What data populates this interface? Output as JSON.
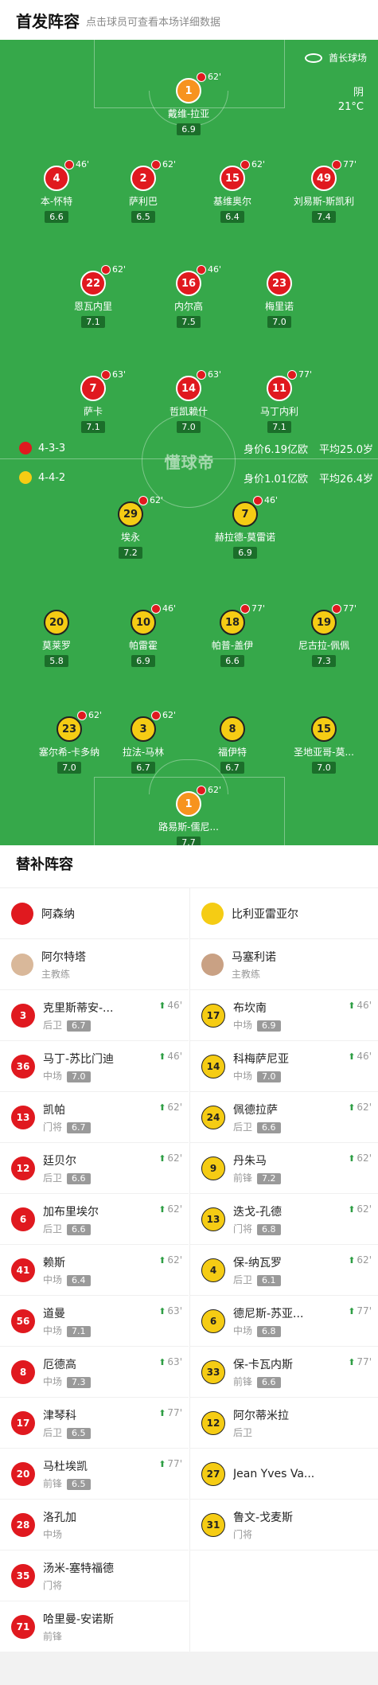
{
  "header": {
    "title": "首发阵容",
    "subtitle": "点击球员可查看本场详细数据"
  },
  "pitch": {
    "stadium": "酋长球场",
    "weather": "阴",
    "temperature": "21°C",
    "watermark": "懂球帝",
    "home": {
      "formation": "4-3-3",
      "value": "身价6.19亿欧",
      "avg_age": "平均25.0岁",
      "color": "#e0191f"
    },
    "away": {
      "formation": "4-4-2",
      "value": "身价1.01亿欧",
      "avg_age": "平均26.4岁",
      "color": "#f5cc14"
    },
    "players": [
      {
        "num": "1",
        "name": "戴维-拉亚",
        "rating": "6.9",
        "sub": "62'",
        "side": "gk"
      },
      {
        "num": "4",
        "name": "本-怀特",
        "rating": "6.6",
        "sub": "46'",
        "side": "home"
      },
      {
        "num": "2",
        "name": "萨利巴",
        "rating": "6.5",
        "sub": "62'",
        "side": "home"
      },
      {
        "num": "15",
        "name": "基维奥尔",
        "rating": "6.4",
        "sub": "62'",
        "side": "home"
      },
      {
        "num": "49",
        "name": "刘易斯-斯凯利",
        "rating": "7.4",
        "sub": "77'",
        "side": "home"
      },
      {
        "num": "22",
        "name": "恩瓦内里",
        "rating": "7.1",
        "sub": "62'",
        "side": "home"
      },
      {
        "num": "16",
        "name": "内尔高",
        "rating": "7.5",
        "sub": "46'",
        "side": "home"
      },
      {
        "num": "23",
        "name": "梅里诺",
        "rating": "7.0",
        "sub": "",
        "side": "home"
      },
      {
        "num": "7",
        "name": "萨卡",
        "rating": "7.1",
        "sub": "63'",
        "side": "home"
      },
      {
        "num": "14",
        "name": "哲凯赖什",
        "rating": "7.0",
        "sub": "63'",
        "side": "home"
      },
      {
        "num": "11",
        "name": "马丁内利",
        "rating": "7.1",
        "sub": "77'",
        "side": "home"
      },
      {
        "num": "29",
        "name": "埃永",
        "rating": "7.2",
        "sub": "62'",
        "side": "away"
      },
      {
        "num": "7",
        "name": "赫拉德-莫雷诺",
        "rating": "6.9",
        "sub": "46'",
        "side": "away"
      },
      {
        "num": "20",
        "name": "莫莱罗",
        "rating": "5.8",
        "sub": "",
        "side": "away"
      },
      {
        "num": "10",
        "name": "帕雷霍",
        "rating": "6.9",
        "sub": "46'",
        "side": "away"
      },
      {
        "num": "18",
        "name": "帕普-盖伊",
        "rating": "6.6",
        "sub": "77'",
        "side": "away"
      },
      {
        "num": "19",
        "name": "尼古拉-佩佩",
        "rating": "7.3",
        "sub": "77'",
        "side": "away"
      },
      {
        "num": "23",
        "name": "塞尔希-卡多纳",
        "rating": "7.0",
        "sub": "62'",
        "side": "away"
      },
      {
        "num": "3",
        "name": "拉法-马林",
        "rating": "6.7",
        "sub": "62'",
        "side": "away"
      },
      {
        "num": "8",
        "name": "福伊特",
        "rating": "6.7",
        "sub": "",
        "side": "away"
      },
      {
        "num": "15",
        "name": "圣地亚哥-莫...",
        "rating": "7.0",
        "sub": "",
        "side": "away"
      },
      {
        "num": "1",
        "name": "路易斯-儒尼...",
        "rating": "7.7",
        "sub": "62'",
        "side": "gk"
      }
    ]
  },
  "subs_section": {
    "title": "替补阵容"
  },
  "home_subs": {
    "team": "阿森纳",
    "coach": "阿尔特塔",
    "coach_role": "主教练",
    "players": [
      {
        "num": "3",
        "name": "克里斯蒂安-...",
        "pos": "后卫",
        "rating": "6.7",
        "min": "46'"
      },
      {
        "num": "36",
        "name": "马丁-苏比门迪",
        "pos": "中场",
        "rating": "7.0",
        "min": "46'"
      },
      {
        "num": "13",
        "name": "凯帕",
        "pos": "门将",
        "rating": "6.7",
        "min": "62'"
      },
      {
        "num": "12",
        "name": "廷贝尔",
        "pos": "后卫",
        "rating": "6.6",
        "min": "62'"
      },
      {
        "num": "6",
        "name": "加布里埃尔",
        "pos": "后卫",
        "rating": "6.6",
        "min": "62'"
      },
      {
        "num": "41",
        "name": "赖斯",
        "pos": "中场",
        "rating": "6.4",
        "min": "62'"
      },
      {
        "num": "56",
        "name": "道曼",
        "pos": "中场",
        "rating": "7.1",
        "min": "63'"
      },
      {
        "num": "8",
        "name": "厄德高",
        "pos": "中场",
        "rating": "7.3",
        "min": "63'"
      },
      {
        "num": "17",
        "name": "津琴科",
        "pos": "后卫",
        "rating": "6.5",
        "min": "77'"
      },
      {
        "num": "20",
        "name": "马杜埃凯",
        "pos": "前锋",
        "rating": "6.5",
        "min": "77'"
      },
      {
        "num": "28",
        "name": "洛孔加",
        "pos": "中场",
        "rating": "",
        "min": ""
      },
      {
        "num": "35",
        "name": "汤米-塞特福德",
        "pos": "门将",
        "rating": "",
        "min": ""
      },
      {
        "num": "71",
        "name": "哈里曼-安诺斯",
        "pos": "前锋",
        "rating": "",
        "min": ""
      }
    ]
  },
  "away_subs": {
    "team": "比利亚雷亚尔",
    "coach": "马塞利诺",
    "coach_role": "主教练",
    "players": [
      {
        "num": "17",
        "name": "布坎南",
        "pos": "中场",
        "rating": "6.9",
        "min": "46'"
      },
      {
        "num": "14",
        "name": "科梅萨尼亚",
        "pos": "中场",
        "rating": "7.0",
        "min": "46'"
      },
      {
        "num": "24",
        "name": "佩德拉萨",
        "pos": "后卫",
        "rating": "6.6",
        "min": "62'"
      },
      {
        "num": "9",
        "name": "丹朱马",
        "pos": "前锋",
        "rating": "7.2",
        "min": "62'"
      },
      {
        "num": "13",
        "name": "迭戈-孔德",
        "pos": "门将",
        "rating": "6.8",
        "min": "62'"
      },
      {
        "num": "4",
        "name": "保-纳瓦罗",
        "pos": "后卫",
        "rating": "6.1",
        "min": "62'"
      },
      {
        "num": "6",
        "name": "德尼斯-苏亚...",
        "pos": "中场",
        "rating": "6.8",
        "min": "77'"
      },
      {
        "num": "33",
        "name": "保-卡瓦内斯",
        "pos": "前锋",
        "rating": "6.6",
        "min": "77'"
      },
      {
        "num": "12",
        "name": "阿尔蒂米拉",
        "pos": "后卫",
        "rating": "",
        "min": ""
      },
      {
        "num": "27",
        "name": "Jean Yves Va...",
        "pos": "",
        "rating": "",
        "min": ""
      },
      {
        "num": "31",
        "name": "鲁文-戈麦斯",
        "pos": "门将",
        "rating": "",
        "min": ""
      }
    ]
  }
}
